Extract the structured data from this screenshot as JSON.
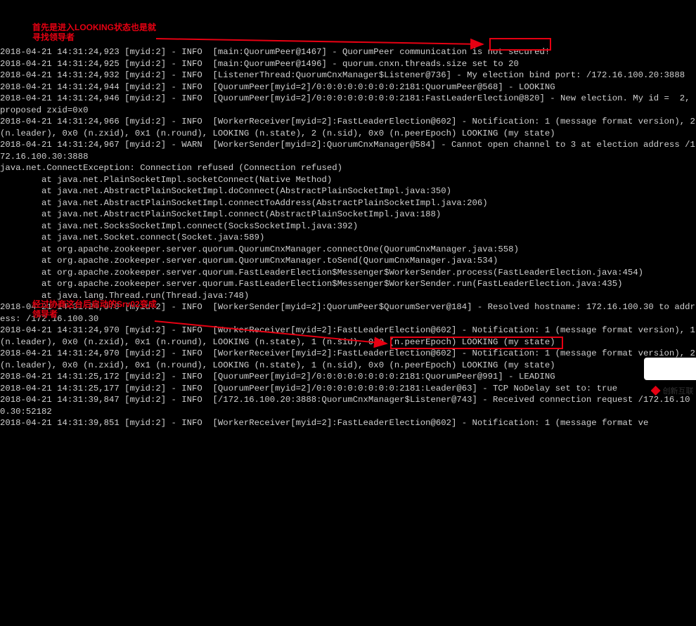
{
  "annotations": {
    "note1": "首先是进入LOOKING状态也是就寻找领导者",
    "note2": "经过协商这台后启动的Srv02变成领导者"
  },
  "watermark": "创新互联",
  "lines": [
    "2018-04-21 14:31:24,923 [myid:2] - INFO  [main:QuorumPeer@1467] - QuorumPeer communication is not secured!",
    "2018-04-21 14:31:24,925 [myid:2] - INFO  [main:QuorumPeer@1496] - quorum.cnxn.threads.size set to 20",
    "2018-04-21 14:31:24,932 [myid:2] - INFO  [ListenerThread:QuorumCnxManager$Listener@736] - My election bind port: /172.16.100.20:3888",
    "2018-04-21 14:31:24,944 [myid:2] - INFO  [QuorumPeer[myid=2]/0:0:0:0:0:0:0:0:2181:QuorumPeer@568] - LOOKING",
    "2018-04-21 14:31:24,946 [myid:2] - INFO  [QuorumPeer[myid=2]/0:0:0:0:0:0:0:0:2181:FastLeaderElection@820] - New election. My id =  2, proposed zxid=0x0",
    "2018-04-21 14:31:24,966 [myid:2] - INFO  [WorkerReceiver[myid=2]:FastLeaderElection@602] - Notification: 1 (message format version), 2 (n.leader), 0x0 (n.zxid), 0x1 (n.round), LOOKING (n.state), 2 (n.sid), 0x0 (n.peerEpoch) LOOKING (my state)",
    "2018-04-21 14:31:24,967 [myid:2] - WARN  [WorkerSender[myid=2]:QuorumCnxManager@584] - Cannot open channel to 3 at election address /172.16.100.30:3888",
    "java.net.ConnectException: Connection refused (Connection refused)",
    "        at java.net.PlainSocketImpl.socketConnect(Native Method)",
    "        at java.net.AbstractPlainSocketImpl.doConnect(AbstractPlainSocketImpl.java:350)",
    "        at java.net.AbstractPlainSocketImpl.connectToAddress(AbstractPlainSocketImpl.java:206)",
    "        at java.net.AbstractPlainSocketImpl.connect(AbstractPlainSocketImpl.java:188)",
    "        at java.net.SocksSocketImpl.connect(SocksSocketImpl.java:392)",
    "        at java.net.Socket.connect(Socket.java:589)",
    "        at org.apache.zookeeper.server.quorum.QuorumCnxManager.connectOne(QuorumCnxManager.java:558)",
    "        at org.apache.zookeeper.server.quorum.QuorumCnxManager.toSend(QuorumCnxManager.java:534)",
    "        at org.apache.zookeeper.server.quorum.FastLeaderElection$Messenger$WorkerSender.process(FastLeaderElection.java:454)",
    "        at org.apache.zookeeper.server.quorum.FastLeaderElection$Messenger$WorkerSender.run(FastLeaderElection.java:435)",
    "        at java.lang.Thread.run(Thread.java:748)",
    "2018-04-21 14:31:24,970 [myid:2] - INFO  [WorkerSender[myid=2]:QuorumPeer$QuorumServer@184] - Resolved hostname: 172.16.100.30 to address: /172.16.100.30",
    "2018-04-21 14:31:24,970 [myid:2] - INFO  [WorkerReceiver[myid=2]:FastLeaderElection@602] - Notification: 1 (message format version), 1 (n.leader), 0x0 (n.zxid), 0x1 (n.round), LOOKING (n.state), 1 (n.sid), 0x0 (n.peerEpoch) LOOKING (my state)",
    "2018-04-21 14:31:24,970 [myid:2] - INFO  [WorkerReceiver[myid=2]:FastLeaderElection@602] - Notification: 1 (message format version), 2 (n.leader), 0x0 (n.zxid), 0x1 (n.round), LOOKING (n.state), 1 (n.sid), 0x0 (n.peerEpoch) LOOKING (my state)",
    "2018-04-21 14:31:25,172 [myid:2] - INFO  [QuorumPeer[myid=2]/0:0:0:0:0:0:0:0:2181:QuorumPeer@991] - LEADING",
    "2018-04-21 14:31:25,177 [myid:2] - INFO  [QuorumPeer[myid=2]/0:0:0:0:0:0:0:0:2181:Leader@63] - TCP NoDelay set to: true",
    "2018-04-21 14:31:39,847 [myid:2] - INFO  [/172.16.100.20:3888:QuorumCnxManager$Listener@743] - Received connection request /172.16.100.30:52182",
    "2018-04-21 14:31:39,851 [myid:2] - INFO  [WorkerReceiver[myid=2]:FastLeaderElection@602] - Notification: 1 (message format ve"
  ]
}
